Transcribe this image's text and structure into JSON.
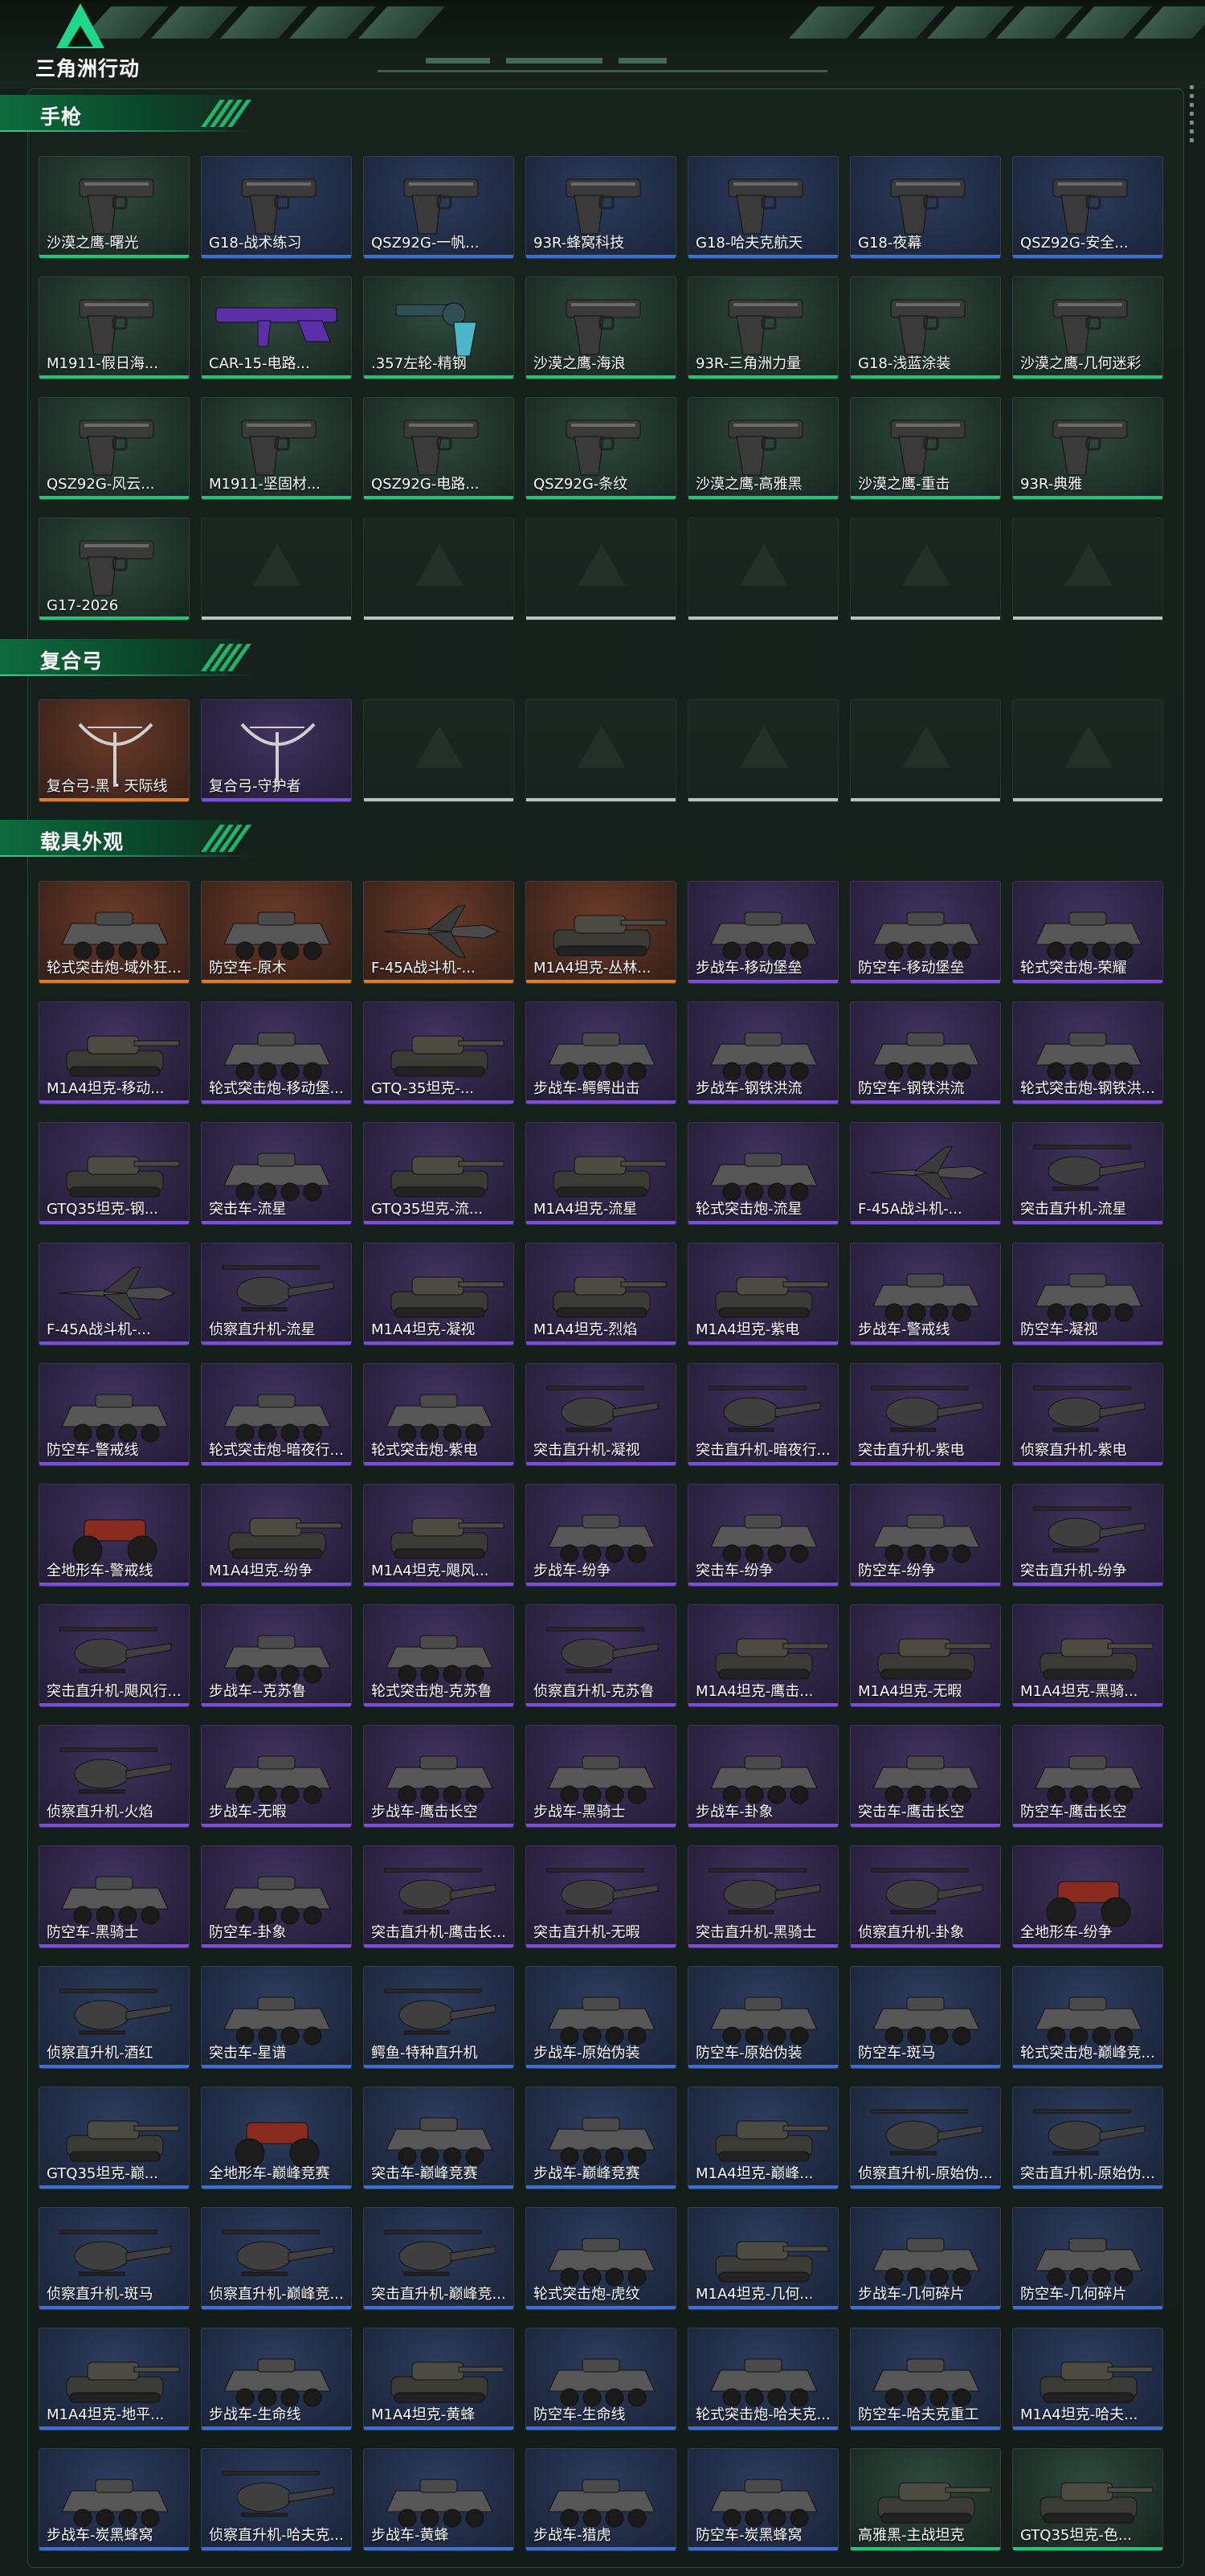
{
  "brand": {
    "logo_text": "三角洲行动",
    "accent": "#1ed78a"
  },
  "sections": [
    {
      "title": "手枪",
      "empty_count": 6,
      "items": [
        {
          "label": "沙漠之鹰-曙光",
          "rarity": "green",
          "icon": "pistol-icon"
        },
        {
          "label": "G18-战术练习",
          "rarity": "blue",
          "icon": "pistol-icon"
        },
        {
          "label": "QSZ92G-一帆...",
          "rarity": "blue",
          "icon": "pistol-icon"
        },
        {
          "label": "93R-蜂窝科技",
          "rarity": "blue",
          "icon": "pistol-icon"
        },
        {
          "label": "G18-哈夫克航天",
          "rarity": "blue",
          "icon": "pistol-icon"
        },
        {
          "label": "G18-夜幕",
          "rarity": "blue",
          "icon": "pistol-icon"
        },
        {
          "label": "QSZ92G-安全...",
          "rarity": "blue",
          "icon": "pistol-icon"
        },
        {
          "label": "M1911-假日海...",
          "rarity": "green",
          "icon": "pistol-icon"
        },
        {
          "label": "CAR-15-电路...",
          "rarity": "green",
          "icon": "rifle-icon"
        },
        {
          "label": ".357左轮-精钢",
          "rarity": "green",
          "icon": "revolver-icon"
        },
        {
          "label": "沙漠之鹰-海浪",
          "rarity": "green",
          "icon": "pistol-icon"
        },
        {
          "label": "93R-三角洲力量",
          "rarity": "green",
          "icon": "pistol-icon"
        },
        {
          "label": "G18-浅蓝涂装",
          "rarity": "green",
          "icon": "pistol-icon"
        },
        {
          "label": "沙漠之鹰-几何迷彩",
          "rarity": "green",
          "icon": "pistol-icon"
        },
        {
          "label": "QSZ92G-风云...",
          "rarity": "green",
          "icon": "pistol-icon"
        },
        {
          "label": "M1911-坚固材...",
          "rarity": "green",
          "icon": "pistol-icon"
        },
        {
          "label": "QSZ92G-电路...",
          "rarity": "green",
          "icon": "pistol-icon"
        },
        {
          "label": "QSZ92G-条纹",
          "rarity": "green",
          "icon": "pistol-icon"
        },
        {
          "label": "沙漠之鹰-高雅黑",
          "rarity": "green",
          "icon": "pistol-icon"
        },
        {
          "label": "沙漠之鹰-重击",
          "rarity": "green",
          "icon": "pistol-icon"
        },
        {
          "label": "93R-典雅",
          "rarity": "green",
          "icon": "pistol-icon"
        },
        {
          "label": "G17-2026",
          "rarity": "green",
          "icon": "pistol-icon"
        }
      ]
    },
    {
      "title": "复合弓",
      "empty_count": 5,
      "items": [
        {
          "label": "复合弓-黑・天际线",
          "rarity": "orange",
          "icon": "bow-icon"
        },
        {
          "label": "复合弓-守护者",
          "rarity": "purple",
          "icon": "bow-icon"
        }
      ]
    },
    {
      "title": "载具外观",
      "empty_count": 0,
      "items": [
        {
          "label": "轮式突击炮-域外狂...",
          "rarity": "orange",
          "icon": "armored-car-icon"
        },
        {
          "label": "防空车-原木",
          "rarity": "orange",
          "icon": "armored-car-icon"
        },
        {
          "label": "F-45A战斗机-...",
          "rarity": "orange",
          "icon": "jet-icon"
        },
        {
          "label": "M1A4坦克-丛林...",
          "rarity": "orange",
          "icon": "tank-icon"
        },
        {
          "label": "步战车-移动堡垒",
          "rarity": "purple",
          "icon": "armored-car-icon"
        },
        {
          "label": "防空车-移动堡垒",
          "rarity": "purple",
          "icon": "armored-car-icon"
        },
        {
          "label": "轮式突击炮-荣耀",
          "rarity": "purple",
          "icon": "armored-car-icon"
        },
        {
          "label": "M1A4坦克-移动...",
          "rarity": "purple",
          "icon": "tank-icon"
        },
        {
          "label": "轮式突击炮-移动堡...",
          "rarity": "purple",
          "icon": "armored-car-icon"
        },
        {
          "label": "GTQ-35坦克-...",
          "rarity": "purple",
          "icon": "tank-icon"
        },
        {
          "label": "步战车-鳄鳄出击",
          "rarity": "purple",
          "icon": "armored-car-icon"
        },
        {
          "label": "步战车-钢铁洪流",
          "rarity": "purple",
          "icon": "armored-car-icon"
        },
        {
          "label": "防空车-钢铁洪流",
          "rarity": "purple",
          "icon": "armored-car-icon"
        },
        {
          "label": "轮式突击炮-钢铁洪...",
          "rarity": "purple",
          "icon": "armored-car-icon"
        },
        {
          "label": "GTQ35坦克-钢...",
          "rarity": "purple",
          "icon": "tank-icon"
        },
        {
          "label": "突击车-流星",
          "rarity": "purple",
          "icon": "armored-car-icon"
        },
        {
          "label": "GTQ35坦克-流...",
          "rarity": "purple",
          "icon": "tank-icon"
        },
        {
          "label": "M1A4坦克-流星",
          "rarity": "purple",
          "icon": "tank-icon"
        },
        {
          "label": "轮式突击炮-流星",
          "rarity": "purple",
          "icon": "armored-car-icon"
        },
        {
          "label": "F-45A战斗机-...",
          "rarity": "purple",
          "icon": "jet-icon"
        },
        {
          "label": "突击直升机-流星",
          "rarity": "purple",
          "icon": "helicopter-icon"
        },
        {
          "label": "F-45A战斗机-...",
          "rarity": "purple",
          "icon": "jet-icon"
        },
        {
          "label": "侦察直升机-流星",
          "rarity": "purple",
          "icon": "helicopter-icon"
        },
        {
          "label": "M1A4坦克-凝视",
          "rarity": "purple",
          "icon": "tank-icon"
        },
        {
          "label": "M1A4坦克-烈焰",
          "rarity": "purple",
          "icon": "tank-icon"
        },
        {
          "label": "M1A4坦克-紫电",
          "rarity": "purple",
          "icon": "tank-icon"
        },
        {
          "label": "步战车-警戒线",
          "rarity": "purple",
          "icon": "armored-car-icon"
        },
        {
          "label": "防空车-凝视",
          "rarity": "purple",
          "icon": "armored-car-icon"
        },
        {
          "label": "防空车-警戒线",
          "rarity": "purple",
          "icon": "armored-car-icon"
        },
        {
          "label": "轮式突击炮-暗夜行...",
          "rarity": "purple",
          "icon": "armored-car-icon"
        },
        {
          "label": "轮式突击炮-紫电",
          "rarity": "purple",
          "icon": "armored-car-icon"
        },
        {
          "label": "突击直升机-凝视",
          "rarity": "purple",
          "icon": "helicopter-icon"
        },
        {
          "label": "突击直升机-暗夜行...",
          "rarity": "purple",
          "icon": "helicopter-icon"
        },
        {
          "label": "突击直升机-紫电",
          "rarity": "purple",
          "icon": "helicopter-icon"
        },
        {
          "label": "侦察直升机-紫电",
          "rarity": "purple",
          "icon": "helicopter-icon"
        },
        {
          "label": "全地形车-警戒线",
          "rarity": "purple",
          "icon": "atv-icon"
        },
        {
          "label": "M1A4坦克-纷争",
          "rarity": "purple",
          "icon": "tank-icon"
        },
        {
          "label": "M1A4坦克-飓风...",
          "rarity": "purple",
          "icon": "tank-icon"
        },
        {
          "label": "步战车-纷争",
          "rarity": "purple",
          "icon": "armored-car-icon"
        },
        {
          "label": "突击车-纷争",
          "rarity": "purple",
          "icon": "armored-car-icon"
        },
        {
          "label": "防空车-纷争",
          "rarity": "purple",
          "icon": "armored-car-icon"
        },
        {
          "label": "突击直升机-纷争",
          "rarity": "purple",
          "icon": "helicopter-icon"
        },
        {
          "label": "突击直升机-飓风行...",
          "rarity": "purple",
          "icon": "helicopter-icon"
        },
        {
          "label": "步战车--克苏鲁",
          "rarity": "purple",
          "icon": "armored-car-icon"
        },
        {
          "label": "轮式突击炮-克苏鲁",
          "rarity": "purple",
          "icon": "armored-car-icon"
        },
        {
          "label": "侦察直升机-克苏鲁",
          "rarity": "purple",
          "icon": "helicopter-icon"
        },
        {
          "label": "M1A4坦克-鹰击...",
          "rarity": "purple",
          "icon": "tank-icon"
        },
        {
          "label": "M1A4坦克-无暇",
          "rarity": "purple",
          "icon": "tank-icon"
        },
        {
          "label": "M1A4坦克-黑骑...",
          "rarity": "purple",
          "icon": "tank-icon"
        },
        {
          "label": "侦察直升机-火焰",
          "rarity": "purple",
          "icon": "helicopter-icon"
        },
        {
          "label": "步战车-无暇",
          "rarity": "purple",
          "icon": "armored-car-icon"
        },
        {
          "label": "步战车-鹰击长空",
          "rarity": "purple",
          "icon": "armored-car-icon"
        },
        {
          "label": "步战车-黑骑士",
          "rarity": "purple",
          "icon": "armored-car-icon"
        },
        {
          "label": "步战车-卦象",
          "rarity": "purple",
          "icon": "armored-car-icon"
        },
        {
          "label": "突击车-鹰击长空",
          "rarity": "purple",
          "icon": "armored-car-icon"
        },
        {
          "label": "防空车-鹰击长空",
          "rarity": "purple",
          "icon": "armored-car-icon"
        },
        {
          "label": "防空车-黑骑士",
          "rarity": "purple",
          "icon": "armored-car-icon"
        },
        {
          "label": "防空车-卦象",
          "rarity": "purple",
          "icon": "armored-car-icon"
        },
        {
          "label": "突击直升机-鹰击长...",
          "rarity": "purple",
          "icon": "helicopter-icon"
        },
        {
          "label": "突击直升机-无暇",
          "rarity": "purple",
          "icon": "helicopter-icon"
        },
        {
          "label": "突击直升机-黑骑士",
          "rarity": "purple",
          "icon": "helicopter-icon"
        },
        {
          "label": "侦察直升机-卦象",
          "rarity": "purple",
          "icon": "helicopter-icon"
        },
        {
          "label": "全地形车-纷争",
          "rarity": "purple",
          "icon": "atv-icon"
        },
        {
          "label": "侦察直升机-酒红",
          "rarity": "blue",
          "icon": "helicopter-icon"
        },
        {
          "label": "突击车-星谱",
          "rarity": "blue",
          "icon": "armored-car-icon"
        },
        {
          "label": "鳄鱼-特种直升机",
          "rarity": "blue",
          "icon": "helicopter-icon"
        },
        {
          "label": "步战车-原始伪装",
          "rarity": "blue",
          "icon": "armored-car-icon"
        },
        {
          "label": "防空车-原始伪装",
          "rarity": "blue",
          "icon": "armored-car-icon"
        },
        {
          "label": "防空车-斑马",
          "rarity": "blue",
          "icon": "armored-car-icon"
        },
        {
          "label": "轮式突击炮-巅峰竞...",
          "rarity": "blue",
          "icon": "armored-car-icon"
        },
        {
          "label": "GTQ35坦克-巅...",
          "rarity": "blue",
          "icon": "tank-icon"
        },
        {
          "label": "全地形车-巅峰竞赛",
          "rarity": "blue",
          "icon": "atv-icon"
        },
        {
          "label": "突击车-巅峰竞赛",
          "rarity": "blue",
          "icon": "armored-car-icon"
        },
        {
          "label": "步战车-巅峰竞赛",
          "rarity": "blue",
          "icon": "armored-car-icon"
        },
        {
          "label": "M1A4坦克-巅峰...",
          "rarity": "blue",
          "icon": "tank-icon"
        },
        {
          "label": "侦察直升机-原始伪...",
          "rarity": "blue",
          "icon": "helicopter-icon"
        },
        {
          "label": "突击直升机-原始伪...",
          "rarity": "blue",
          "icon": "helicopter-icon"
        },
        {
          "label": "侦察直升机-斑马",
          "rarity": "blue",
          "icon": "helicopter-icon"
        },
        {
          "label": "侦察直升机-巅峰竞...",
          "rarity": "blue",
          "icon": "helicopter-icon"
        },
        {
          "label": "突击直升机-巅峰竞...",
          "rarity": "blue",
          "icon": "helicopter-icon"
        },
        {
          "label": "轮式突击炮-虎纹",
          "rarity": "blue",
          "icon": "armored-car-icon"
        },
        {
          "label": "M1A4坦克-几何...",
          "rarity": "blue",
          "icon": "tank-icon"
        },
        {
          "label": "步战车-几何碎片",
          "rarity": "blue",
          "icon": "armored-car-icon"
        },
        {
          "label": "防空车-几何碎片",
          "rarity": "blue",
          "icon": "armored-car-icon"
        },
        {
          "label": "M1A4坦克-地平...",
          "rarity": "blue",
          "icon": "tank-icon"
        },
        {
          "label": "步战车-生命线",
          "rarity": "blue",
          "icon": "armored-car-icon"
        },
        {
          "label": "M1A4坦克-黄蜂",
          "rarity": "blue",
          "icon": "tank-icon"
        },
        {
          "label": "防空车-生命线",
          "rarity": "blue",
          "icon": "armored-car-icon"
        },
        {
          "label": "轮式突击炮-哈夫克...",
          "rarity": "blue",
          "icon": "armored-car-icon"
        },
        {
          "label": "防空车-哈夫克重工",
          "rarity": "blue",
          "icon": "armored-car-icon"
        },
        {
          "label": "M1A4坦克-哈夫...",
          "rarity": "blue",
          "icon": "tank-icon"
        },
        {
          "label": "步战车-炭黑蜂窝",
          "rarity": "blue",
          "icon": "armored-car-icon"
        },
        {
          "label": "侦察直升机-哈夫克...",
          "rarity": "blue",
          "icon": "helicopter-icon"
        },
        {
          "label": "步战车-黄蜂",
          "rarity": "blue",
          "icon": "armored-car-icon"
        },
        {
          "label": "步战车-猎虎",
          "rarity": "blue",
          "icon": "armored-car-icon"
        },
        {
          "label": "防空车-炭黑蜂窝",
          "rarity": "blue",
          "icon": "armored-car-icon"
        },
        {
          "label": "高雅黑-主战坦克",
          "rarity": "green",
          "icon": "tank-icon"
        },
        {
          "label": "GTQ35坦克-色...",
          "rarity": "green",
          "icon": "tank-icon"
        }
      ]
    }
  ]
}
